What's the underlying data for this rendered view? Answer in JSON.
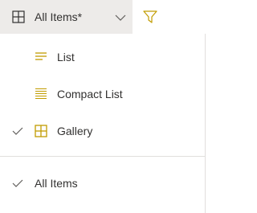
{
  "toolbar": {
    "view_switcher": {
      "label": "All Items*",
      "icon": "gallery-icon"
    },
    "filter_icon": "filter-icon"
  },
  "menu": {
    "items": [
      {
        "label": "List",
        "icon": "list-icon",
        "checked": false
      },
      {
        "label": "Compact List",
        "icon": "compact-list-icon",
        "checked": false
      },
      {
        "label": "Gallery",
        "icon": "gallery-icon",
        "checked": true
      }
    ],
    "saved_views": [
      {
        "label": "All Items",
        "checked": true
      }
    ]
  },
  "colors": {
    "accent": "#c19c00",
    "text": "#323130",
    "selected_bg": "#edebe9",
    "divider": "#e1dfdd"
  }
}
